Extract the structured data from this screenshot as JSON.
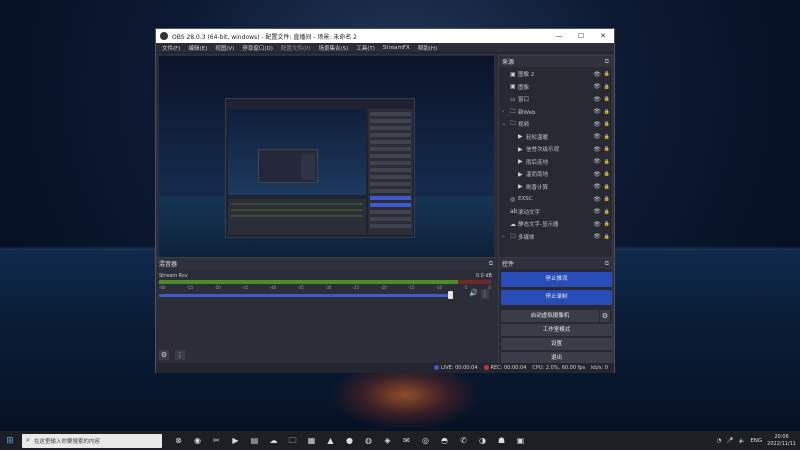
{
  "window": {
    "title": "OBS 28.0.3 (64-bit, windows) - 配置文件: 直播间 - 场景: 未命名 2",
    "controls": [
      "—",
      "☐",
      "✕"
    ]
  },
  "menu": [
    {
      "label": "文件(F)",
      "dim": false
    },
    {
      "label": "编辑(E)",
      "dim": false
    },
    {
      "label": "视图(V)",
      "dim": false
    },
    {
      "label": "停靠窗口(D)",
      "dim": false
    },
    {
      "label": "配置文件(P)",
      "dim": true
    },
    {
      "label": "场景集合(S)",
      "dim": false
    },
    {
      "label": "工具(T)",
      "dim": false
    },
    {
      "label": "StreamFX",
      "dim": false
    },
    {
      "label": "帮助(H)",
      "dim": false
    }
  ],
  "sources": {
    "title": "来源",
    "items": [
      {
        "name": "图像 2",
        "icon": "image-icon",
        "glyph": "▣",
        "indent": 0,
        "expander": "",
        "visible": true
      },
      {
        "name": "图像",
        "icon": "image-icon",
        "glyph": "▣",
        "indent": 0,
        "expander": "",
        "visible": true
      },
      {
        "name": "窗口",
        "icon": "window-icon",
        "glyph": "▭",
        "indent": 0,
        "expander": "",
        "visible": true
      },
      {
        "name": "新Web",
        "icon": "folder-icon",
        "glyph": "🗀",
        "indent": 0,
        "expander": "›",
        "visible": true
      },
      {
        "name": "视频",
        "icon": "folder-icon",
        "glyph": "🗀",
        "indent": 0,
        "expander": "⌄",
        "visible": true
      },
      {
        "name": "轻松温暖",
        "icon": "play-icon",
        "glyph": "▶",
        "indent": 1,
        "expander": "",
        "visible": true
      },
      {
        "name": "信誉次级乐观",
        "icon": "play-icon",
        "glyph": "▶",
        "indent": 1,
        "expander": "",
        "visible": true
      },
      {
        "name": "雨后连地",
        "icon": "play-icon",
        "glyph": "▶",
        "indent": 1,
        "expander": "",
        "visible": true
      },
      {
        "name": "温而南地",
        "icon": "play-icon",
        "glyph": "▶",
        "indent": 1,
        "expander": "",
        "visible": true
      },
      {
        "name": "刷香计算",
        "icon": "play-icon",
        "glyph": "▶",
        "indent": 1,
        "expander": "",
        "visible": true
      },
      {
        "name": "EXSC",
        "icon": "globe-icon",
        "glyph": "◎",
        "indent": 0,
        "expander": "",
        "visible": true
      },
      {
        "name": "滚动文字",
        "icon": "text-icon",
        "glyph": "ab",
        "indent": 0,
        "expander": "",
        "visible": true
      },
      {
        "name": "静态文字-显示器",
        "icon": "capture-icon",
        "glyph": "☁",
        "indent": 0,
        "expander": "",
        "visible": true
      },
      {
        "name": "多媒体",
        "icon": "folder-icon",
        "glyph": "🗀",
        "indent": 0,
        "expander": "›",
        "visible": true
      }
    ],
    "toolbar": [
      "+",
      "🗑",
      "⚙",
      "▲",
      "▼"
    ]
  },
  "mixer": {
    "title": "混音器",
    "channel": "Stream Rsv",
    "db": "0.0 dB",
    "level": 0.9,
    "volume": 0.95,
    "scale": [
      "-60",
      "-55",
      "-50",
      "-45",
      "-40",
      "-35",
      "-30",
      "-25",
      "-20",
      "-15",
      "-10",
      "-5",
      "0"
    ]
  },
  "controls": {
    "title": "控件",
    "start_stream": "停止推流",
    "start_record": "停止录制",
    "virtual_cam": "启动虚拟摄像机",
    "studio_mode": "工作室模式",
    "settings": "设置",
    "exit": "退出"
  },
  "status": {
    "live": "LIVE: 00:00:04",
    "rec": "REC: 00:00:04",
    "cpu": "CPU: 2.0%, 60.00 fps",
    "kbps": "kb/s: 0"
  },
  "taskbar": {
    "search_placeholder": "在这里输入你要搜索的内容",
    "icons": [
      "xbox-icon",
      "obs-icon",
      "media-icon",
      "game-icon",
      "app-icon",
      "cloud-icon",
      "folder-icon",
      "notes-icon",
      "photo-icon",
      "obs-record-icon",
      "chrome-icon",
      "vpn-icon",
      "wechat-icon",
      "steam-icon",
      "edge-icon",
      "mail-icon",
      "discord-icon",
      "game2-icon",
      "app2-icon"
    ],
    "glyphs": [
      "⊗",
      "◉",
      "✂",
      "▶",
      "▤",
      "☁",
      "🗀",
      "▦",
      "▲",
      "●",
      "◍",
      "◈",
      "✉",
      "◎",
      "◓",
      "✆",
      "◑",
      "☗",
      "▣"
    ],
    "time": "20:06",
    "date": "2022/11/11",
    "lang": "ENG"
  },
  "colors": {
    "accent": "#284cb8",
    "live": "#3c5bd1",
    "rec": "#c0392b"
  }
}
